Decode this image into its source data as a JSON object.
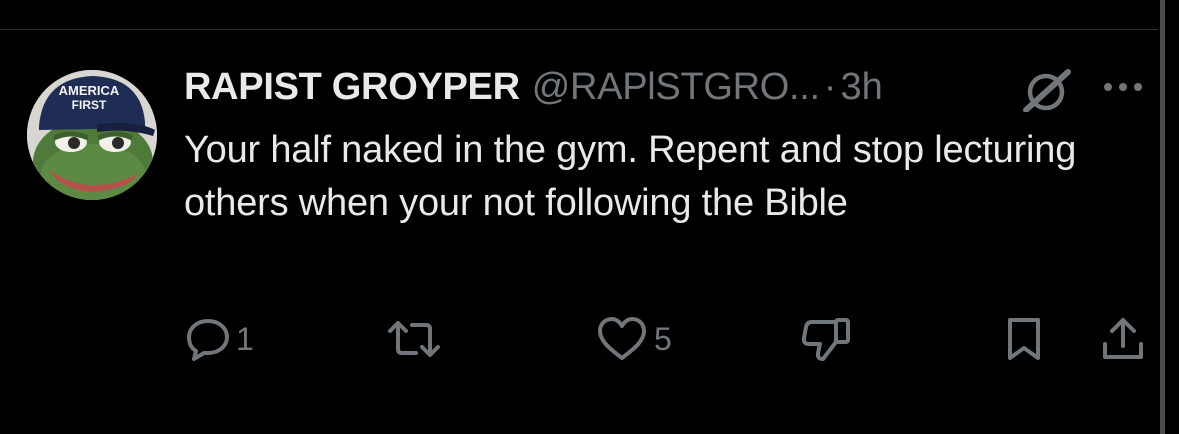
{
  "tweet": {
    "display_name": "RAPIST GROYPER",
    "handle": "@RAPlSTGRO...",
    "separator": "·",
    "time": "3h",
    "text": "Your half naked in the gym. Repent and stop lecturing others when your not following the Bible"
  },
  "avatar": {
    "hat_line1": "AMERICA",
    "hat_line2": "FIRST"
  },
  "actions": {
    "reply_count": "1",
    "like_count": "5"
  },
  "icons": {
    "grok": "grok-icon",
    "more": "more-icon",
    "reply": "reply-icon",
    "retweet": "retweet-icon",
    "like": "heart-icon",
    "dislike": "thumbs-down-icon",
    "bookmark": "bookmark-icon",
    "share": "share-icon"
  },
  "colors": {
    "background": "#000000",
    "text": "#e7e9ea",
    "muted": "#71767b"
  }
}
